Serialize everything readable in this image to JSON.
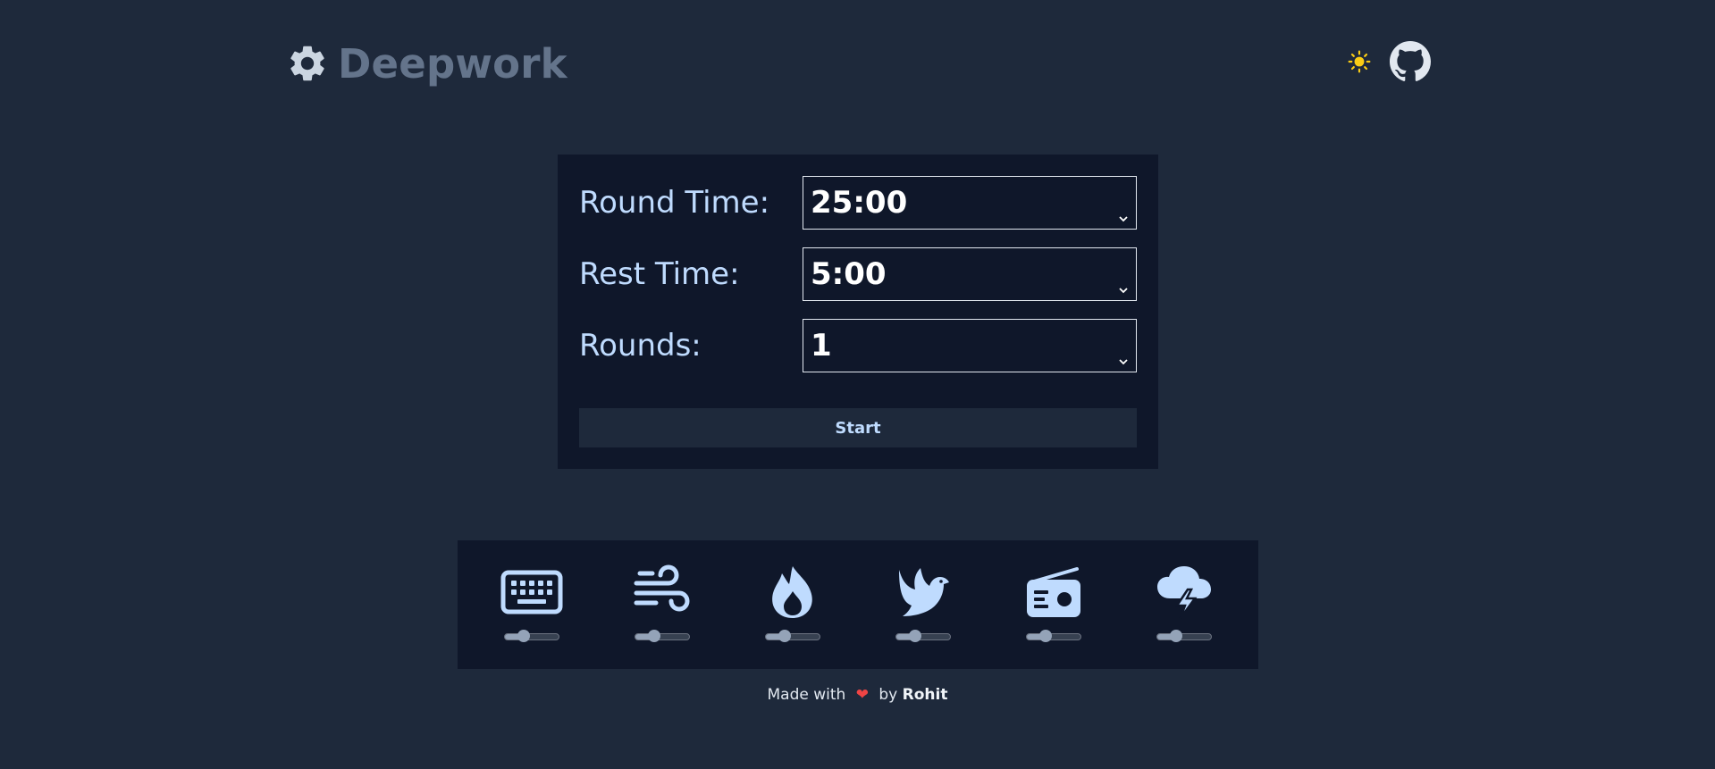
{
  "header": {
    "title": "Deepwork",
    "logo_icon": "gear-icon",
    "theme_icon": "sun-icon",
    "github_icon": "github-icon"
  },
  "form": {
    "round_time": {
      "label": "Round Time:",
      "value": "25:00"
    },
    "rest_time": {
      "label": "Rest Time:",
      "value": "5:00"
    },
    "rounds": {
      "label": "Rounds:",
      "value": "1"
    },
    "start_label": "Start"
  },
  "sounds": [
    {
      "name": "keyboard",
      "icon": "keyboard-icon",
      "volume": 0.35
    },
    {
      "name": "wind",
      "icon": "wind-icon",
      "volume": 0.35
    },
    {
      "name": "fire",
      "icon": "fire-icon",
      "volume": 0.35
    },
    {
      "name": "bird",
      "icon": "dove-icon",
      "volume": 0.35
    },
    {
      "name": "radio",
      "icon": "radio-icon",
      "volume": 0.35
    },
    {
      "name": "storm",
      "icon": "cloud-lightning-icon",
      "volume": 0.35
    }
  ],
  "footer": {
    "prefix": "Made with",
    "middle": "by",
    "author": "Rohit"
  },
  "colors": {
    "background": "#1e293b",
    "panel": "#0f172a",
    "accent": "#bfdbfe",
    "title": "#64748b",
    "sun": "#facc15",
    "heart": "#ef4444"
  }
}
